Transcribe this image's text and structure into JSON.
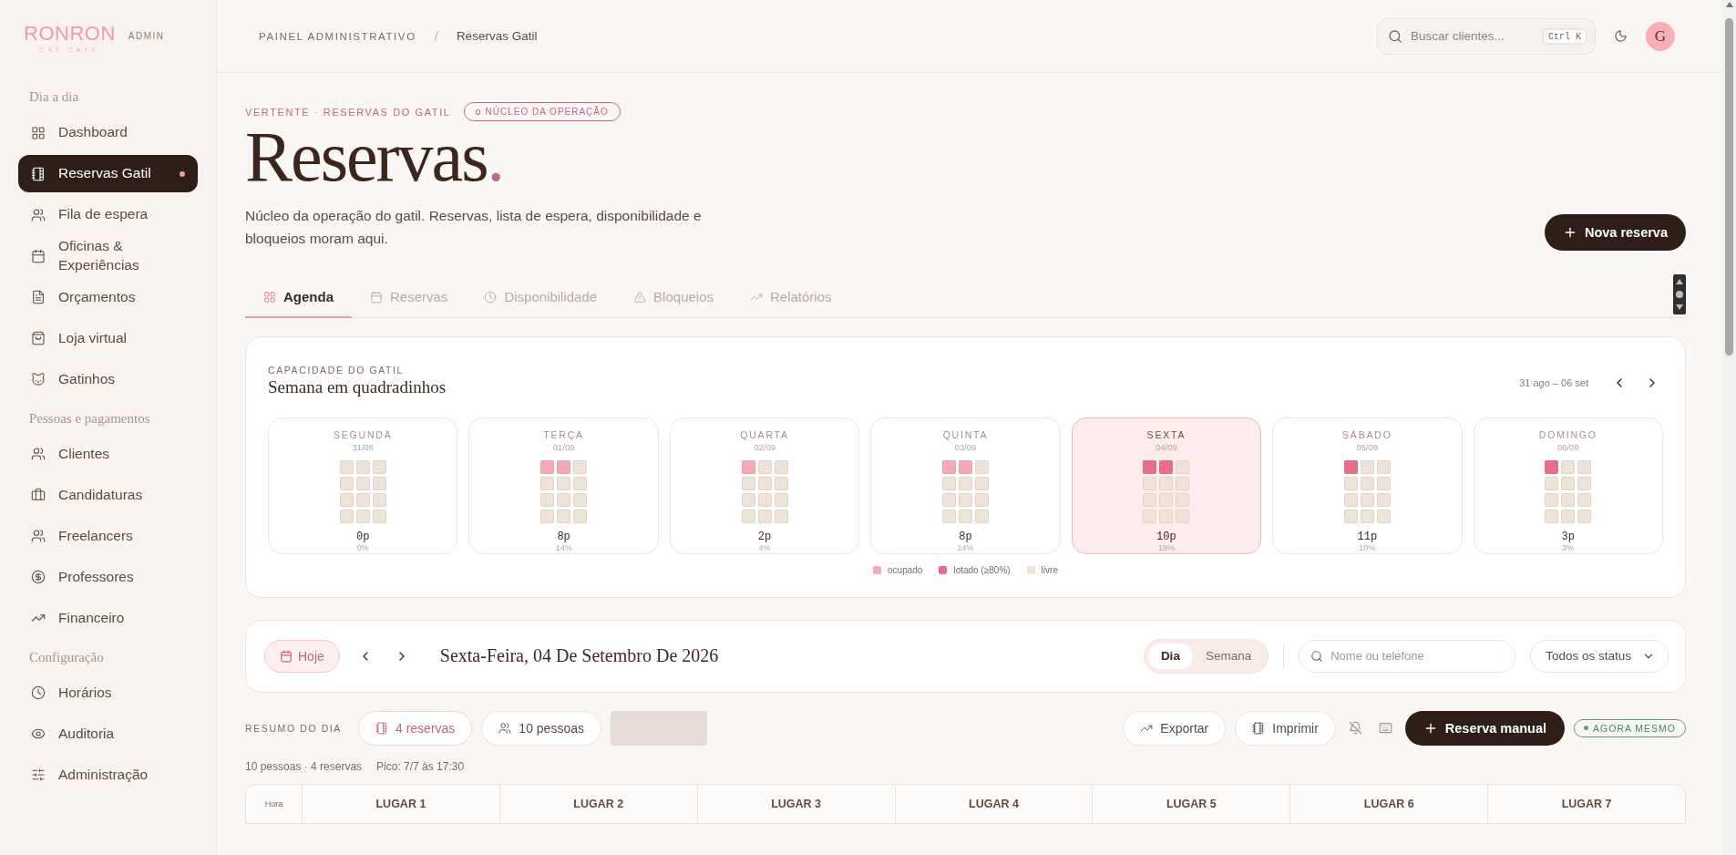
{
  "brand": {
    "name": "RONRON",
    "tagline": "CAT CAFE",
    "badge": "ADMIN"
  },
  "sidebar": {
    "sections": [
      {
        "title": "Dia a dia",
        "items": [
          {
            "label": "Dashboard",
            "selected": false,
            "dot": false
          },
          {
            "label": "Reservas Gatil",
            "selected": true,
            "dot": true
          },
          {
            "label": "Fila de espera",
            "selected": false,
            "dot": false
          },
          {
            "label": "Oficinas & Experiências",
            "selected": false,
            "dot": false
          },
          {
            "label": "Orçamentos",
            "selected": false,
            "dot": false
          },
          {
            "label": "Loja virtual",
            "selected": false,
            "dot": false
          },
          {
            "label": "Gatinhos",
            "selected": false,
            "dot": false
          }
        ]
      },
      {
        "title": "Pessoas e pagamentos",
        "items": [
          {
            "label": "Clientes",
            "selected": false,
            "dot": false
          },
          {
            "label": "Candidaturas",
            "selected": false,
            "dot": false
          },
          {
            "label": "Freelancers",
            "selected": false,
            "dot": false
          },
          {
            "label": "Professores",
            "selected": false,
            "dot": false
          },
          {
            "label": "Financeiro",
            "selected": false,
            "dot": false
          }
        ]
      },
      {
        "title": "Configuração",
        "items": [
          {
            "label": "Horários",
            "selected": false,
            "dot": false
          },
          {
            "label": "Auditoria",
            "selected": false,
            "dot": false
          },
          {
            "label": "Administração",
            "selected": false,
            "dot": false
          }
        ]
      }
    ]
  },
  "header": {
    "breadcrumb": [
      "PAINEL ADMINISTRATIVO",
      "Reservas Gatil"
    ],
    "separator": "/",
    "search": {
      "placeholder": "Buscar clientes...",
      "shortcut": "Ctrl K"
    },
    "avatar": "G"
  },
  "hero": {
    "eyebrow": "VERTENTE · RESERVAS DO GATIL",
    "tag": "NÚCLEO DA OPERAÇÃO",
    "title": "Reservas",
    "title_dot": ".",
    "description": "Núcleo da operação do gatil. Reservas, lista de espera, disponibilidade e bloqueios moram aqui.",
    "action": "Nova reserva"
  },
  "tabs": [
    {
      "label": "Agenda",
      "selected": true
    },
    {
      "label": "Reservas",
      "selected": false
    },
    {
      "label": "Disponibilidade",
      "selected": false
    },
    {
      "label": "Bloqueios",
      "selected": false
    },
    {
      "label": "Relatórios",
      "selected": false
    }
  ],
  "capacity": {
    "eyebrow": "CAPACIDADE DO GATIL",
    "title": "Semana em quadradinhos",
    "range": "31 ago – 06 set",
    "days": [
      {
        "name": "SEGUNDA",
        "date": "31/08",
        "people": "0p",
        "percent": "0%",
        "selected": false,
        "cells": [
          {
            "kind": "livre"
          },
          {
            "kind": "livre"
          },
          {
            "kind": "livre"
          },
          {
            "kind": "livre"
          },
          {
            "kind": "livre"
          },
          {
            "kind": "livre"
          },
          {
            "kind": "livre"
          },
          {
            "kind": "livre"
          },
          {
            "kind": "livre"
          },
          {
            "kind": "livre"
          },
          {
            "kind": "livre"
          },
          {
            "kind": "livre"
          }
        ]
      },
      {
        "name": "TERÇA",
        "date": "01/09",
        "people": "8p",
        "percent": "14%",
        "selected": false,
        "cells": [
          {
            "kind": "ocupado"
          },
          {
            "kind": "ocupado"
          },
          {
            "kind": "livre"
          },
          {
            "kind": "livre"
          },
          {
            "kind": "livre"
          },
          {
            "kind": "livre"
          },
          {
            "kind": "livre"
          },
          {
            "kind": "livre"
          },
          {
            "kind": "livre"
          },
          {
            "kind": "livre"
          },
          {
            "kind": "livre"
          },
          {
            "kind": "livre"
          }
        ]
      },
      {
        "name": "QUARTA",
        "date": "02/09",
        "people": "2p",
        "percent": "4%",
        "selected": false,
        "cells": [
          {
            "kind": "ocupado"
          },
          {
            "kind": "livre"
          },
          {
            "kind": "livre"
          },
          {
            "kind": "livre"
          },
          {
            "kind": "livre"
          },
          {
            "kind": "livre"
          },
          {
            "kind": "livre"
          },
          {
            "kind": "livre"
          },
          {
            "kind": "livre"
          },
          {
            "kind": "livre"
          },
          {
            "kind": "livre"
          },
          {
            "kind": "livre"
          }
        ]
      },
      {
        "name": "QUINTA",
        "date": "03/09",
        "people": "8p",
        "percent": "14%",
        "selected": false,
        "cells": [
          {
            "kind": "ocupado"
          },
          {
            "kind": "ocupado"
          },
          {
            "kind": "livre"
          },
          {
            "kind": "livre"
          },
          {
            "kind": "livre"
          },
          {
            "kind": "livre"
          },
          {
            "kind": "livre"
          },
          {
            "kind": "livre"
          },
          {
            "kind": "livre"
          },
          {
            "kind": "livre"
          },
          {
            "kind": "livre"
          },
          {
            "kind": "livre"
          }
        ]
      },
      {
        "name": "SEXTA",
        "date": "04/09",
        "people": "10p",
        "percent": "18%",
        "selected": true,
        "cells": [
          {
            "kind": "lotado"
          },
          {
            "kind": "lotado"
          },
          {
            "kind": "livre"
          },
          {
            "kind": "livre"
          },
          {
            "kind": "livre"
          },
          {
            "kind": "livre"
          },
          {
            "kind": "livre"
          },
          {
            "kind": "livre"
          },
          {
            "kind": "livre"
          },
          {
            "kind": "livre"
          },
          {
            "kind": "livre"
          },
          {
            "kind": "livre"
          }
        ]
      },
      {
        "name": "SÁBADO",
        "date": "05/09",
        "people": "11p",
        "percent": "10%",
        "selected": false,
        "cells": [
          {
            "kind": "lotado"
          },
          {
            "kind": "livre"
          },
          {
            "kind": "livre"
          },
          {
            "kind": "livre"
          },
          {
            "kind": "livre"
          },
          {
            "kind": "livre"
          },
          {
            "kind": "livre"
          },
          {
            "kind": "livre"
          },
          {
            "kind": "livre"
          },
          {
            "kind": "livre"
          },
          {
            "kind": "livre"
          },
          {
            "kind": "livre"
          }
        ]
      },
      {
        "name": "DOMINGO",
        "date": "06/09",
        "people": "3p",
        "percent": "3%",
        "selected": false,
        "cells": [
          {
            "kind": "lotado"
          },
          {
            "kind": "livre"
          },
          {
            "kind": "livre"
          },
          {
            "kind": "livre"
          },
          {
            "kind": "livre"
          },
          {
            "kind": "livre"
          },
          {
            "kind": "livre"
          },
          {
            "kind": "livre"
          },
          {
            "kind": "livre"
          },
          {
            "kind": "livre"
          },
          {
            "kind": "livre"
          },
          {
            "kind": "livre"
          }
        ]
      }
    ],
    "legend": [
      {
        "kind": "ocupado",
        "label": "ocupado"
      },
      {
        "kind": "lotado",
        "label": "lotado (≥80%)"
      },
      {
        "kind": "livre",
        "label": "livre"
      }
    ]
  },
  "day_toolbar": {
    "today": "Hoje",
    "date": "Sexta-Feira, 04 De Setembro De 2026",
    "views": [
      {
        "label": "Dia",
        "selected": true
      },
      {
        "label": "Semana",
        "selected": false
      }
    ],
    "search": {
      "placeholder": "Nome ou telefone"
    },
    "status_filter": "Todos os status"
  },
  "summary": {
    "title": "RESUMO DO DIA",
    "chips": [
      {
        "label": "4 reservas",
        "highlighted": true
      },
      {
        "label": "10 pessoas",
        "highlighted": false
      }
    ],
    "actions": [
      {
        "label": "Exportar"
      },
      {
        "label": "Imprimir"
      }
    ],
    "manual": "Reserva manual",
    "live": "AGORA MESMO",
    "meta": "10 pessoas · 4 reservas",
    "peak": "Pico: 7/7 às 17:30"
  },
  "schedule": {
    "columns": [
      "Hora",
      "LUGAR 1",
      "LUGAR 2",
      "LUGAR 3",
      "LUGAR 4",
      "LUGAR 5",
      "LUGAR 6",
      "LUGAR 7"
    ]
  }
}
